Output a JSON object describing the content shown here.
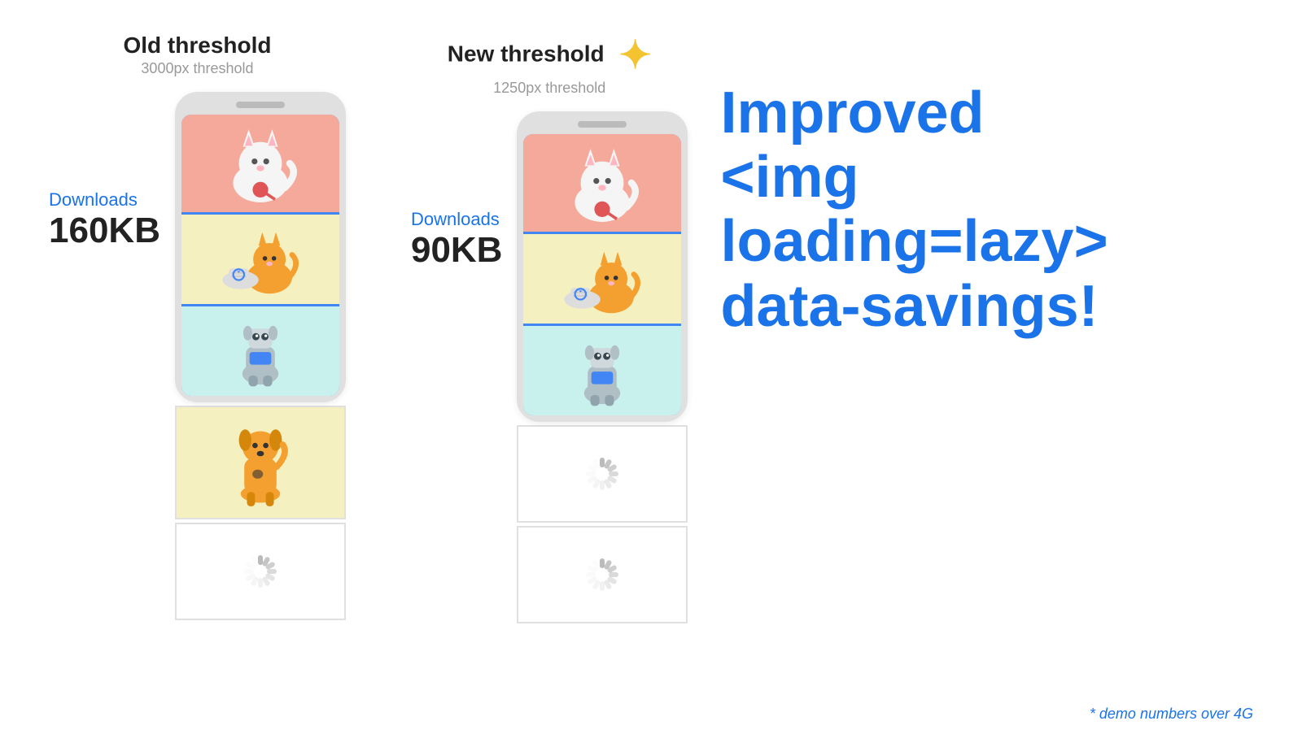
{
  "page": {
    "background": "#ffffff"
  },
  "old_threshold": {
    "title": "Old threshold",
    "subtitle": "3000px threshold",
    "downloads_label": "Downloads",
    "downloads_size": "160KB"
  },
  "new_threshold": {
    "title": "New threshold",
    "subtitle": "1250px threshold",
    "downloads_label": "Downloads",
    "downloads_size": "90KB"
  },
  "headline": {
    "line1": "Improved",
    "line2": "<img loading=lazy>",
    "line3": "data-savings!"
  },
  "demo_note": "* demo numbers over 4G",
  "sparkle_icon": "✦",
  "loading_icon_label": "loading-spinner"
}
